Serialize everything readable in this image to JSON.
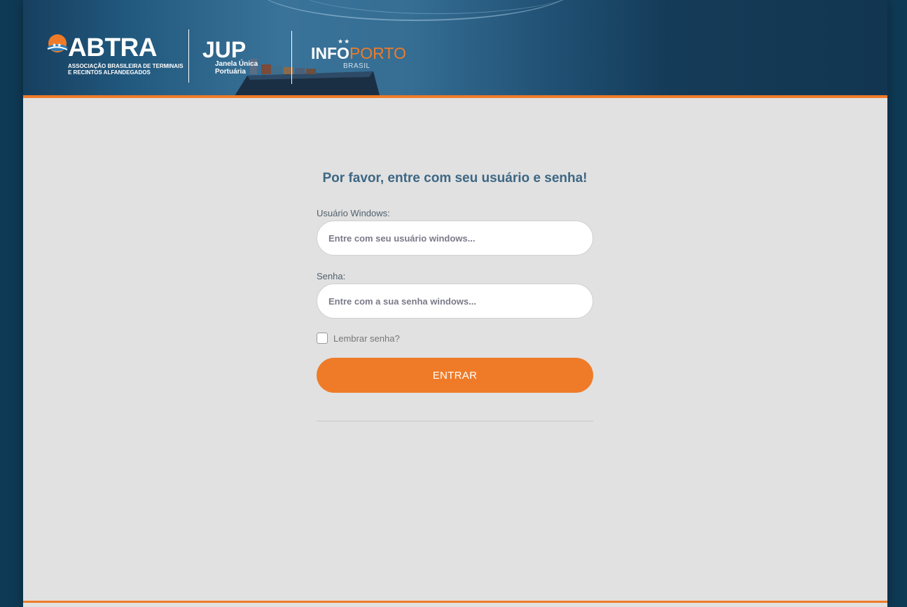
{
  "header": {
    "abtra": {
      "name": "ABTRA",
      "subtitle_line1": "ASSOCIAÇÃO BRASILEIRA DE TERMINAIS",
      "subtitle_line2": "E RECINTOS ALFANDEGADOS"
    },
    "jup": {
      "name": "JUP",
      "subtitle_line1": "Janela Única",
      "subtitle_line2": "Portuária"
    },
    "infoporto": {
      "part1": "INFO",
      "part2": "PORTO",
      "subtitle": "BRASIL"
    }
  },
  "login": {
    "title": "Por favor, entre com seu usuário e senha!",
    "username_label": "Usuário Windows:",
    "username_placeholder": "Entre com seu usuário windows...",
    "username_value": "",
    "password_label": "Senha:",
    "password_placeholder": "Entre com a sua senha windows...",
    "password_value": "",
    "remember_label": "Lembrar senha?",
    "remember_checked": false,
    "submit_label": "ENTRAR"
  },
  "colors": {
    "accent": "#ef7b28",
    "title": "#3d6784",
    "page_background": "#e1e1e1",
    "outer_background": "#0f3a55"
  }
}
